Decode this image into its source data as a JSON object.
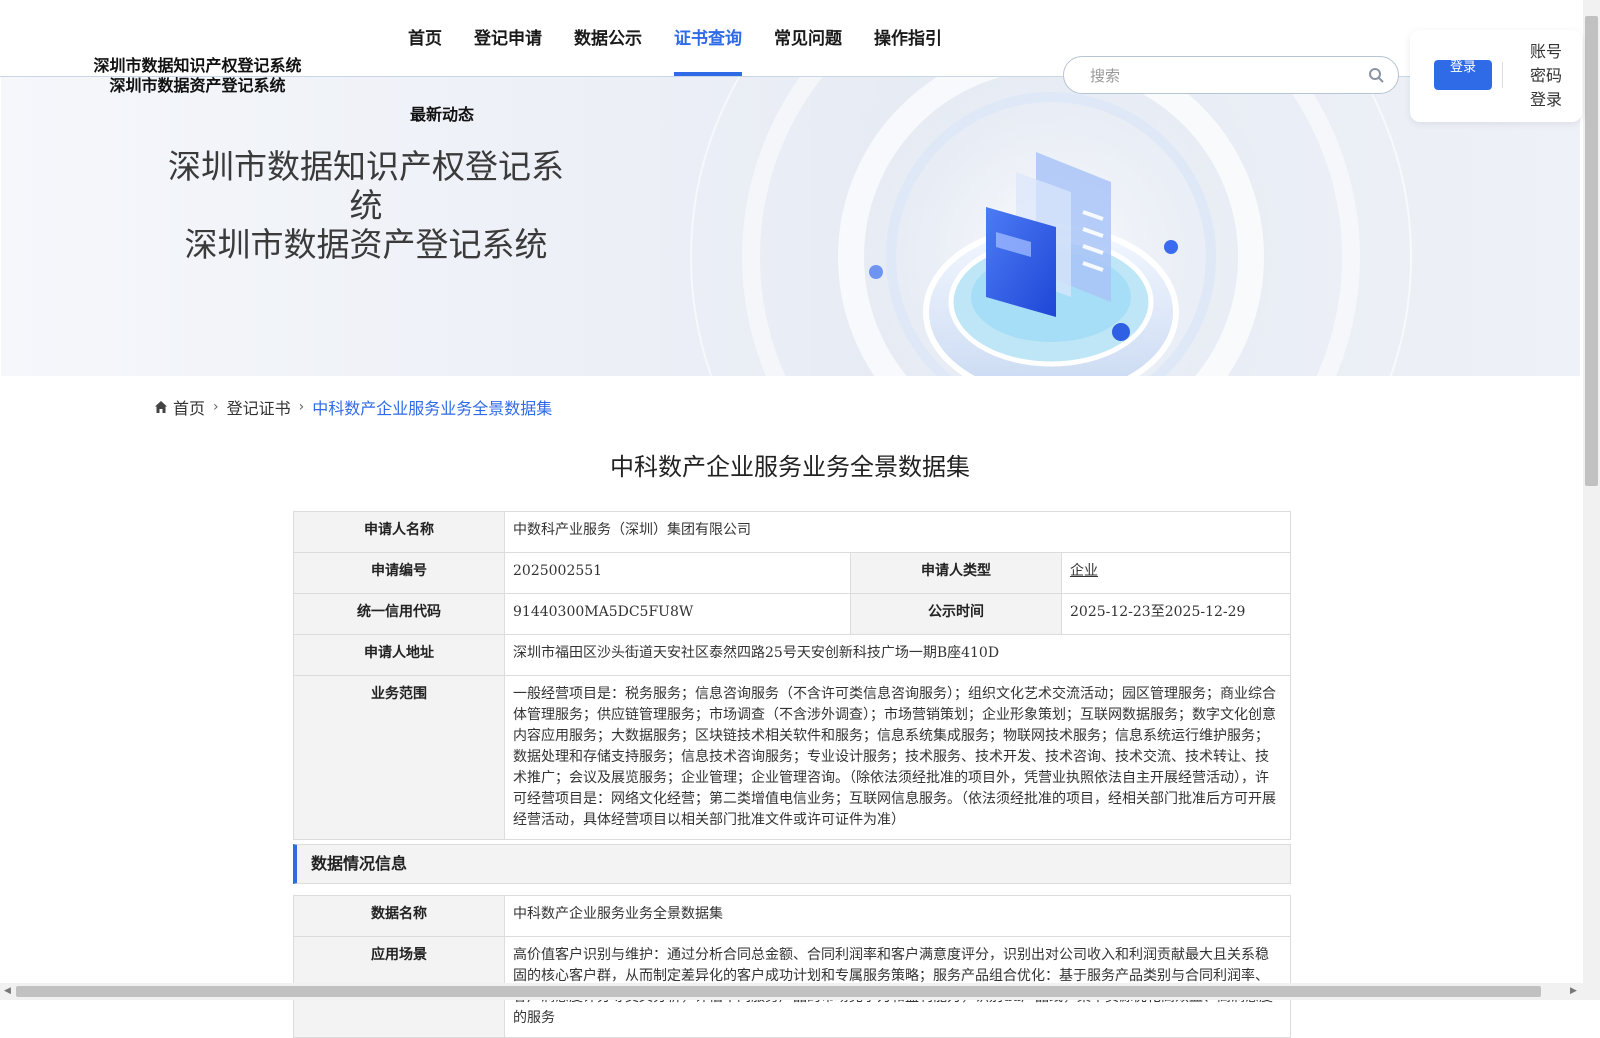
{
  "header": {
    "brand_line1": "深圳市数据知识产权登记系统",
    "brand_line2": "深圳市数据资产登记系统",
    "nav": [
      {
        "label": "首页"
      },
      {
        "label": "登记申请"
      },
      {
        "label": "数据公示"
      },
      {
        "label": "证书查询",
        "active": true
      },
      {
        "label": "常见问题"
      },
      {
        "label": "操作指引"
      }
    ],
    "news_label": "最新动态",
    "search_placeholder": "搜索",
    "login_button": "登录",
    "password_login": "账号密码登录"
  },
  "banner": {
    "title_line1": "深圳市数据知识产权登记系统",
    "title_line2": "深圳市数据资产登记系统"
  },
  "breadcrumb": [
    "首页",
    "登记证书",
    "中科数产企业服务业务全景数据集"
  ],
  "page_title": "中科数产企业服务业务全景数据集",
  "applicant": {
    "name_label": "申请人名称",
    "name": "中数科产业服务（深圳）集团有限公司",
    "number_label": "申请编号",
    "number": "2025002551",
    "type_label": "申请人类型",
    "type": "企业",
    "credit_code_label": "统一信用代码",
    "credit_code": "91440300MA5DC5FU8W",
    "publicity_label": "公示时间",
    "publicity_time": "2025-12-23至2025-12-29",
    "address_label": "申请人地址",
    "address": "深圳市福田区沙头街道天安社区泰然四路25号天安创新科技广场一期B座410D",
    "scope_label": "业务范围",
    "scope": "一般经营项目是：税务服务；信息咨询服务（不含许可类信息咨询服务）；组织文化艺术交流活动；园区管理服务；商业综合体管理服务；供应链管理服务；市场调查（不含涉外调查）；市场营销策划；企业形象策划；互联网数据服务；数字文化创意内容应用服务；大数据服务；区块链技术相关软件和服务；信息系统集成服务；物联网技术服务；信息系统运行维护服务；数据处理和存储支持服务；信息技术咨询服务；专业设计服务；技术服务、技术开发、技术咨询、技术交流、技术转让、技术推广；会议及展览服务；企业管理；企业管理咨询。（除依法须经批准的项目外，凭营业执照依法自主开展经营活动），许可经营项目是：网络文化经营；第二类增值电信业务；互联网信息服务。（依法须经批准的项目，经相关部门批准后方可开展经营活动，具体经营项目以相关部门批准文件或许可证件为准）"
  },
  "data_section": {
    "title": "数据情况信息",
    "data_name_label": "数据名称",
    "data_name": "中科数产企业服务业务全景数据集",
    "scenario_label": "应用场景",
    "scenario": "高价值客户识别与维护：通过分析合同总金额、合同利润率和客户满意度评分，识别出对公司收入和利润贡献最大且关系稳固的核心客户群，从而制定差异化的客户成功计划和专属服务策略；服务产品组合优化：基于服务产品类别与合同利润率、客户满意度评分等交叉分析，评估不同服务产品的市场竞争力和盈利能力，识别du产品线，集中资源优化高效益、高满意度的服务"
  },
  "colors": {
    "accent": "#2f6be7",
    "label_bg": "#f3f3f3",
    "border": "#dcdcdc"
  }
}
